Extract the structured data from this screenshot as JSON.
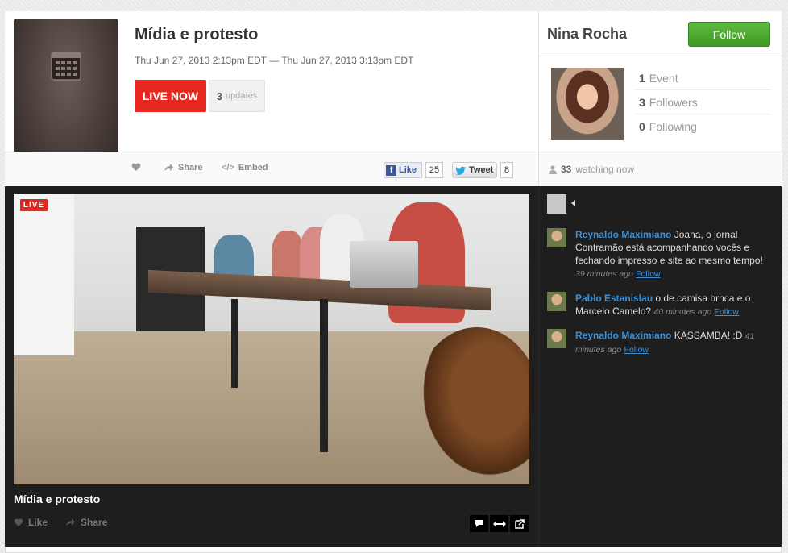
{
  "event": {
    "title": "Mídia e protesto",
    "dates": "Thu Jun 27, 2013 2:13pm EDT — Thu Jun 27, 2013 3:13pm EDT",
    "live_label": "LIVE NOW",
    "updates_count": "3",
    "updates_label": "updates"
  },
  "actions": {
    "share": "Share",
    "embed": "Embed",
    "fb_like": "Like",
    "fb_count": "25",
    "tweet": "Tweet",
    "tweet_count": "8"
  },
  "profile": {
    "name": "Nina Rocha",
    "follow_label": "Follow",
    "stats": [
      {
        "n": "1",
        "label": "Event"
      },
      {
        "n": "3",
        "label": "Followers"
      },
      {
        "n": "0",
        "label": "Following"
      }
    ],
    "watching_count": "33",
    "watching_label": "watching now"
  },
  "player": {
    "live_badge": "LIVE",
    "title": "Mídia e protesto",
    "like": "Like",
    "share": "Share"
  },
  "comments": [
    {
      "author": "Reynaldo Maximiano",
      "text": "Joana, o jornal Contramão está acompanhando vocês e fechando impresso e site ao mesmo tempo!",
      "time": "39 minutes ago",
      "follow": "Follow"
    },
    {
      "author": "Pablo Estanislau",
      "text": "o de camisa brnca e o Marcelo Camelo?",
      "time": "40 minutes ago",
      "follow": "Follow"
    },
    {
      "author": "Reynaldo Maximiano",
      "text": "KASSAMBA! :D",
      "time": "41 minutes ago",
      "follow": "Follow"
    }
  ],
  "colors": {
    "live_red": "#e8281e",
    "follow_green": "#4aa82e",
    "link_blue": "#3b8fd6",
    "dark_bg": "#1e1e1e"
  }
}
